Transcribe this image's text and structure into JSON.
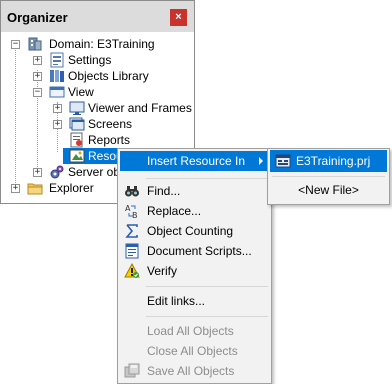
{
  "organizer": {
    "title": "Organizer",
    "close_glyph": "×",
    "tree": {
      "domain": "Domain: E3Training",
      "settings": "Settings",
      "objects_library": "Objects Library",
      "view": "View",
      "viewer_and_frames": "Viewer and Frames",
      "screens": "Screens",
      "reports": "Reports",
      "resources": "Resou",
      "server_objects": "Server obj",
      "explorer": "Explorer"
    }
  },
  "context_menu": {
    "items": [
      {
        "label": "Insert Resource In",
        "icon": "none",
        "highlighted": true,
        "submenu": true
      },
      {
        "label": "Find...",
        "icon": "binoculars-icon"
      },
      {
        "label": "Replace...",
        "icon": "replace-icon"
      },
      {
        "label": "Object Counting",
        "icon": "sigma-icon"
      },
      {
        "label": "Document Scripts...",
        "icon": "document-scripts-icon"
      },
      {
        "label": "Verify",
        "icon": "warning-icon"
      },
      {
        "label": "Edit links...",
        "icon": "none"
      },
      {
        "label": "Load All Objects",
        "icon": "none",
        "disabled": true
      },
      {
        "label": "Close All Objects",
        "icon": "none",
        "disabled": true
      },
      {
        "label": "Save All Objects",
        "icon": "save-all-icon",
        "disabled": true
      }
    ]
  },
  "submenu": {
    "items": [
      {
        "label": "E3Training.prj",
        "icon": "project-icon",
        "highlighted": true
      },
      {
        "label": "<New File>"
      }
    ]
  },
  "colors": {
    "highlight": "#0078d7",
    "close_button": "#c8332e",
    "titlebar": "#dcdcdc",
    "menu_bg": "#f2f2f2"
  }
}
